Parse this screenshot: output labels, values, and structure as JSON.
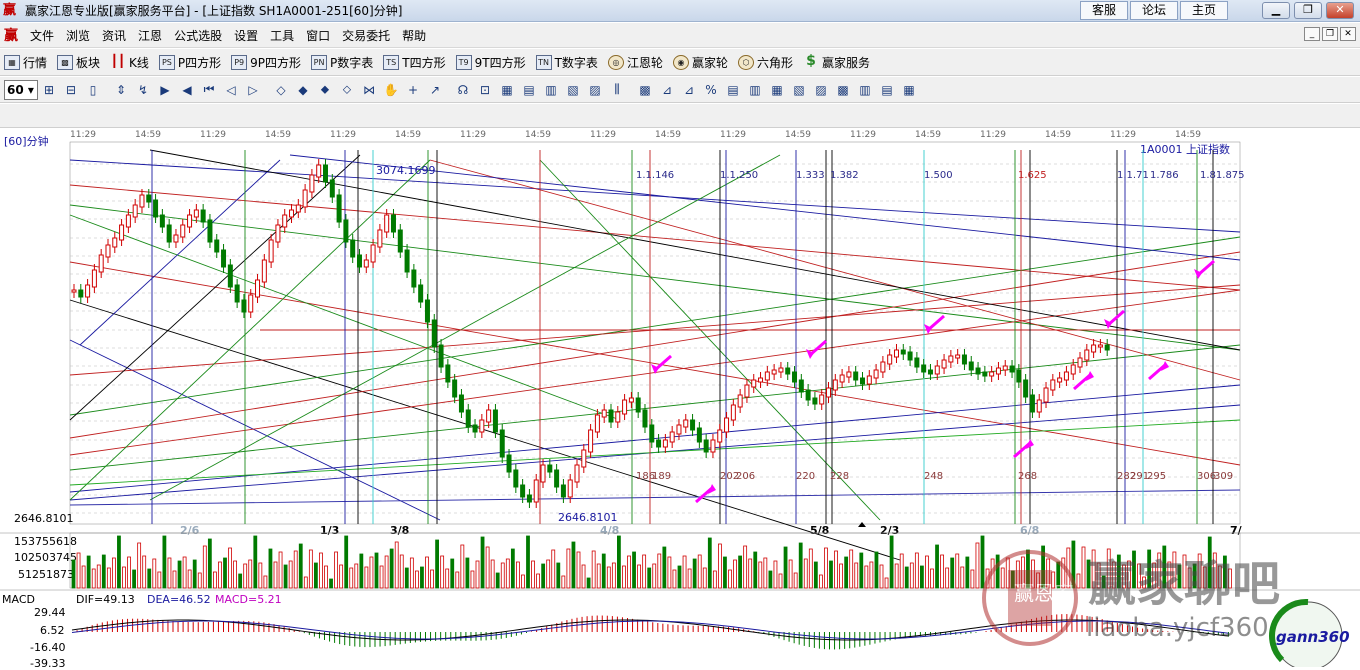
{
  "window": {
    "title": "赢家江恩专业版[赢家服务平台] - [上证指数  SH1A0001-251[60]分钟]",
    "links": [
      "客服",
      "论坛",
      "主页"
    ],
    "logo": "赢"
  },
  "menubar": [
    "文件",
    "浏览",
    "资讯",
    "江恩",
    "公式选股",
    "设置",
    "工具",
    "窗口",
    "交易委托",
    "帮助"
  ],
  "navbar": [
    {
      "icon": "grid-icon",
      "glyph": "▦",
      "label": "行情"
    },
    {
      "icon": "block-icon",
      "glyph": "▩",
      "label": "板块"
    },
    {
      "icon": "kline-icon",
      "glyph": "┃┃",
      "label": "K线"
    },
    {
      "icon": "ps-icon",
      "glyph": "PS",
      "label": "P四方形"
    },
    {
      "icon": "p9-icon",
      "glyph": "P9",
      "label": "9P四方形"
    },
    {
      "icon": "pn-icon",
      "glyph": "PN",
      "label": "P数字表"
    },
    {
      "icon": "ts-icon",
      "glyph": "TS",
      "label": "T四方形"
    },
    {
      "icon": "t9-icon",
      "glyph": "T9",
      "label": "9T四方形"
    },
    {
      "icon": "tn-icon",
      "glyph": "TN",
      "label": "T数字表"
    },
    {
      "icon": "gann-wheel-icon",
      "glyph": "◎",
      "label": "江恩轮"
    },
    {
      "icon": "winner-wheel-icon",
      "glyph": "◉",
      "label": "赢家轮"
    },
    {
      "icon": "hexagon-icon",
      "glyph": "⬡",
      "label": "六角形"
    },
    {
      "icon": "dollar-icon",
      "glyph": "$",
      "label": "赢家服务"
    }
  ],
  "toolbar": {
    "period": "60"
  },
  "chart": {
    "panel_title": "[60]分钟",
    "symbol_label": "1A0001  上证指数",
    "high_label": "3074.1699",
    "low_label": "2646.8101",
    "low_axis_label": "2646.8101",
    "time_axis_labels": [
      "11:29",
      "14:59",
      "11:29",
      "14:59",
      "11:29",
      "14:59",
      "11:29",
      "14:59",
      "11:29",
      "14:59",
      "11:29",
      "14:59",
      "11:29",
      "14:59",
      "11:29",
      "14:59",
      "11:29",
      "14:59"
    ],
    "date_labels": [
      "2/6",
      "1/3",
      "3/8",
      "4/8",
      "5/8",
      "2/3",
      "6/8",
      "7/"
    ],
    "gann_ratios": [
      "1.1.146",
      "1.1.250",
      "1.333",
      "1.382",
      "1.500",
      "1.625",
      "1.1.71",
      "1.786",
      "1.81.875"
    ],
    "cycle_labels": [
      "186",
      "189",
      "202",
      "206",
      "220",
      "228",
      "248",
      "268",
      "282",
      "291",
      "295",
      "306",
      "309"
    ],
    "colors": {
      "up": "#d00000",
      "down": "#007a00",
      "fan_green": "#1a8a1a",
      "fan_red": "#c02020",
      "fan_blue": "#1a1aa0",
      "arrow": "#ff00ff"
    }
  },
  "volume": {
    "axis_labels": [
      "153755618",
      "102503745",
      "51251873"
    ]
  },
  "macd": {
    "title": "MACD",
    "dif_label": "DIF=49.13",
    "dea_label": "DEA=46.52",
    "macd_label": "MACD=5.21",
    "axis_labels": [
      "29.44",
      "6.52",
      "-16.40",
      "-39.33"
    ]
  },
  "watermark": {
    "forum": "赢家聊吧",
    "url": "liaoba.yjcf360.com",
    "seal_text": "赢恩家",
    "gann": "gann360"
  }
}
